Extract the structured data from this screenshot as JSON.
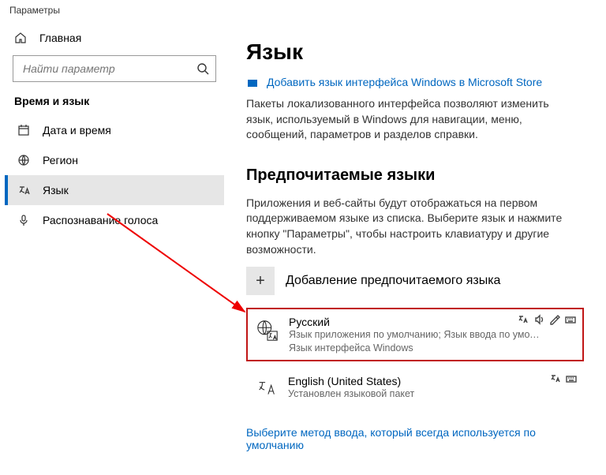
{
  "window": {
    "title": "Параметры"
  },
  "sidebar": {
    "home": "Главная",
    "search_placeholder": "Найти параметр",
    "section": "Время и язык",
    "items": [
      {
        "label": "Дата и время"
      },
      {
        "label": "Регион"
      },
      {
        "label": "Язык"
      },
      {
        "label": "Распознавание голоса"
      }
    ]
  },
  "main": {
    "heading": "Язык",
    "store_link": "Добавить язык интерфейса Windows в Microsoft Store",
    "intro": "Пакеты локализованного интерфейса позволяют изменить язык, используемый в Windows для навигации, меню, сообщений, параметров и разделов справки.",
    "pref_heading": "Предпочитаемые языки",
    "pref_desc": "Приложения и веб-сайты будут отображаться на первом поддерживаемом языке из списка. Выберите язык и нажмите кнопку \"Параметры\", чтобы настроить клавиатуру и другие возможности.",
    "add_label": "Добавление предпочитаемого языка",
    "langs": [
      {
        "name": "Русский",
        "sub": "Язык приложения по умолчанию; Язык ввода по умол…",
        "sub2": "Язык интерфейса Windows"
      },
      {
        "name": "English (United States)",
        "sub": "Установлен языковой пакет",
        "sub2": ""
      }
    ],
    "bottom_link": "Выберите метод ввода, который всегда используется по умолчанию"
  }
}
